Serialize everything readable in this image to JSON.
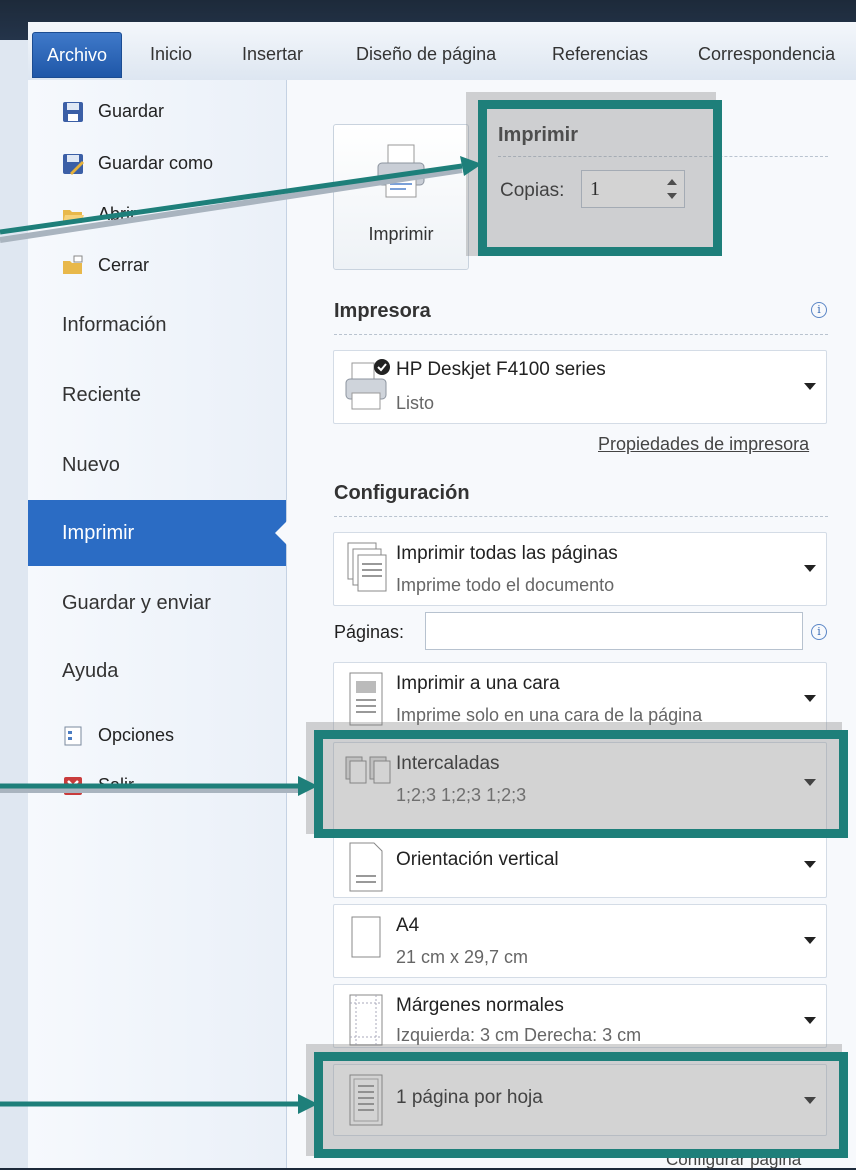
{
  "tabs": [
    "Archivo",
    "Inicio",
    "Insertar",
    "Diseño de página",
    "Referencias",
    "Correspondencia"
  ],
  "file_commands": [
    {
      "label": "Guardar",
      "icon": "save-icon"
    },
    {
      "label": "Guardar como",
      "icon": "save-as-icon"
    },
    {
      "label": "Abrir",
      "icon": "open-folder-icon"
    },
    {
      "label": "Cerrar",
      "icon": "close-folder-icon"
    }
  ],
  "nav": [
    "Información",
    "Reciente",
    "Nuevo",
    "Imprimir",
    "Guardar y enviar",
    "Ayuda"
  ],
  "bottom_commands": [
    {
      "label": "Opciones",
      "icon": "options-icon"
    },
    {
      "label": "Salir",
      "icon": "exit-icon"
    }
  ],
  "print": {
    "button_label": "Imprimir",
    "heading": "Imprimir",
    "copies_label": "Copias:",
    "copies_value": "1"
  },
  "printer": {
    "heading": "Impresora",
    "name": "HP Deskjet F4100 series",
    "status": "Listo",
    "properties_link": "Propiedades de impresora"
  },
  "settings": {
    "heading": "Configuración",
    "pages_label": "Páginas:",
    "pages_value": "",
    "items": [
      {
        "t1": "Imprimir todas las páginas",
        "t2": "Imprime todo el documento"
      },
      {
        "t1": "Imprimir a una cara",
        "t2": "Imprime solo en una cara de la página"
      },
      {
        "t1": "Intercaladas",
        "t2": "1;2;3   1;2;3   1;2;3"
      },
      {
        "t1": "Orientación vertical",
        "t2": ""
      },
      {
        "t1": "A4",
        "t2": "21 cm x 29,7 cm"
      },
      {
        "t1": "Márgenes normales",
        "t2": "Izquierda:  3 cm    Derecha:  3 cm"
      },
      {
        "t1": "1 página por hoja",
        "t2": ""
      }
    ],
    "footer_link": "Configurar página"
  },
  "colors": {
    "accent": "#2b6cc4",
    "highlight": "#1e7f7a"
  }
}
